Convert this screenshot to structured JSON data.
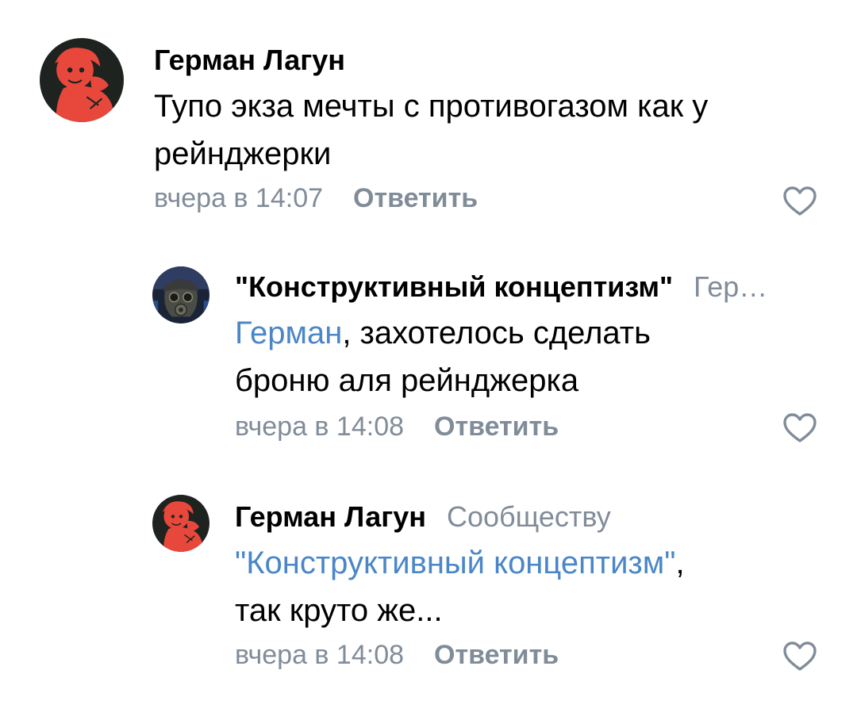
{
  "comments": [
    {
      "author": "Герман Лагун",
      "reply_to": "",
      "text": "Тупо экза мечты с противогазом как у рейнджерки",
      "time": "вчера в 14:07",
      "reply_label": "Ответить",
      "avatar_icon": "red-anime-avatar-icon"
    },
    {
      "author": "\"Конструктивный концептизм\"",
      "reply_to": "Гер…",
      "mention": "Герман",
      "text_line1": ", захотелось сделать",
      "text_line2": "броню аля рейнджерка",
      "time": "вчера в 14:08",
      "reply_label": "Ответить",
      "avatar_icon": "gas-mask-avatar-icon"
    },
    {
      "author": "Герман Лагун",
      "reply_to": "Сообществу",
      "mention": "\"Конструктивный концептизм\"",
      "text_after_mention": ",",
      "text_line2": "так круто же...",
      "time": "вчера в 14:08",
      "reply_label": "Ответить",
      "avatar_icon": "red-anime-avatar-icon"
    }
  ],
  "colors": {
    "secondary_text": "#818c99",
    "link": "#4a86c8",
    "primary_text": "#000000",
    "avatar_red": "#e8483c",
    "avatar_dark": "#1e2320"
  }
}
